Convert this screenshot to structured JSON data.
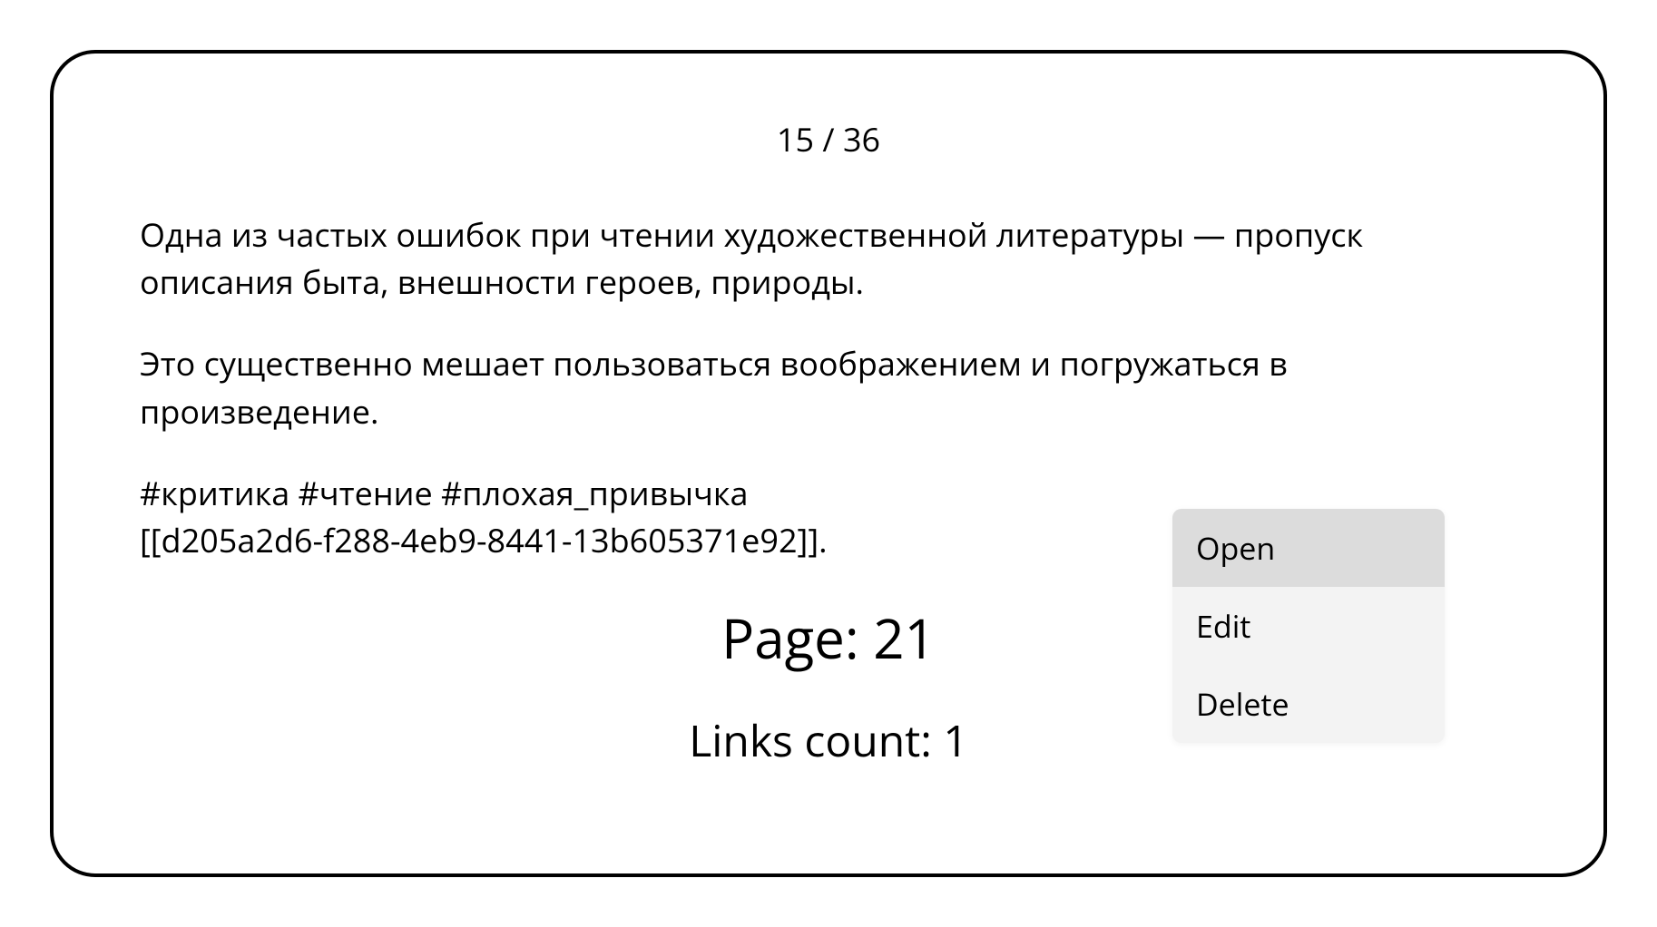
{
  "counter": "15 / 36",
  "paragraphs": [
    "Одна из частых ошибок при чтении художественной литературы — пропуск описания быта, внешности героев, природы.",
    "Это существенно мешает пользоваться воображением и погружаться в произведение."
  ],
  "tags_line": "#критика #чтение #плохая_привычка",
  "link_ref": "[[d205a2d6-f288-4eb9-8441-13b605371e92]].",
  "page_label": "Page: 21",
  "links_count_label": "Links count: 1",
  "context_menu": {
    "items": [
      {
        "label": "Open",
        "highlighted": true
      },
      {
        "label": "Edit",
        "highlighted": false
      },
      {
        "label": "Delete",
        "highlighted": false
      }
    ]
  }
}
